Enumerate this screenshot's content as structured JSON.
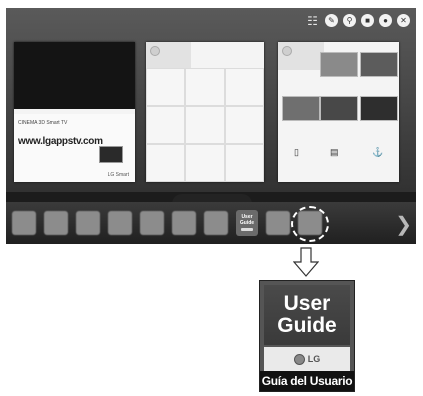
{
  "topbar": {
    "icons": [
      "tv-icon",
      "pencil-icon",
      "search-icon",
      "screen-icon",
      "user-icon",
      "close-icon"
    ]
  },
  "card1": {
    "brand": "CINEMA 3D Smart TV",
    "tagline": "www.lgappstv.com",
    "logo_text": "LG Smart"
  },
  "dock": {
    "user_guide_label_1": "User",
    "user_guide_label_2": "Guide"
  },
  "detail": {
    "title_1": "User",
    "title_2": "Guide",
    "logo_text": "LG",
    "caption": "Guía del Usuario"
  }
}
